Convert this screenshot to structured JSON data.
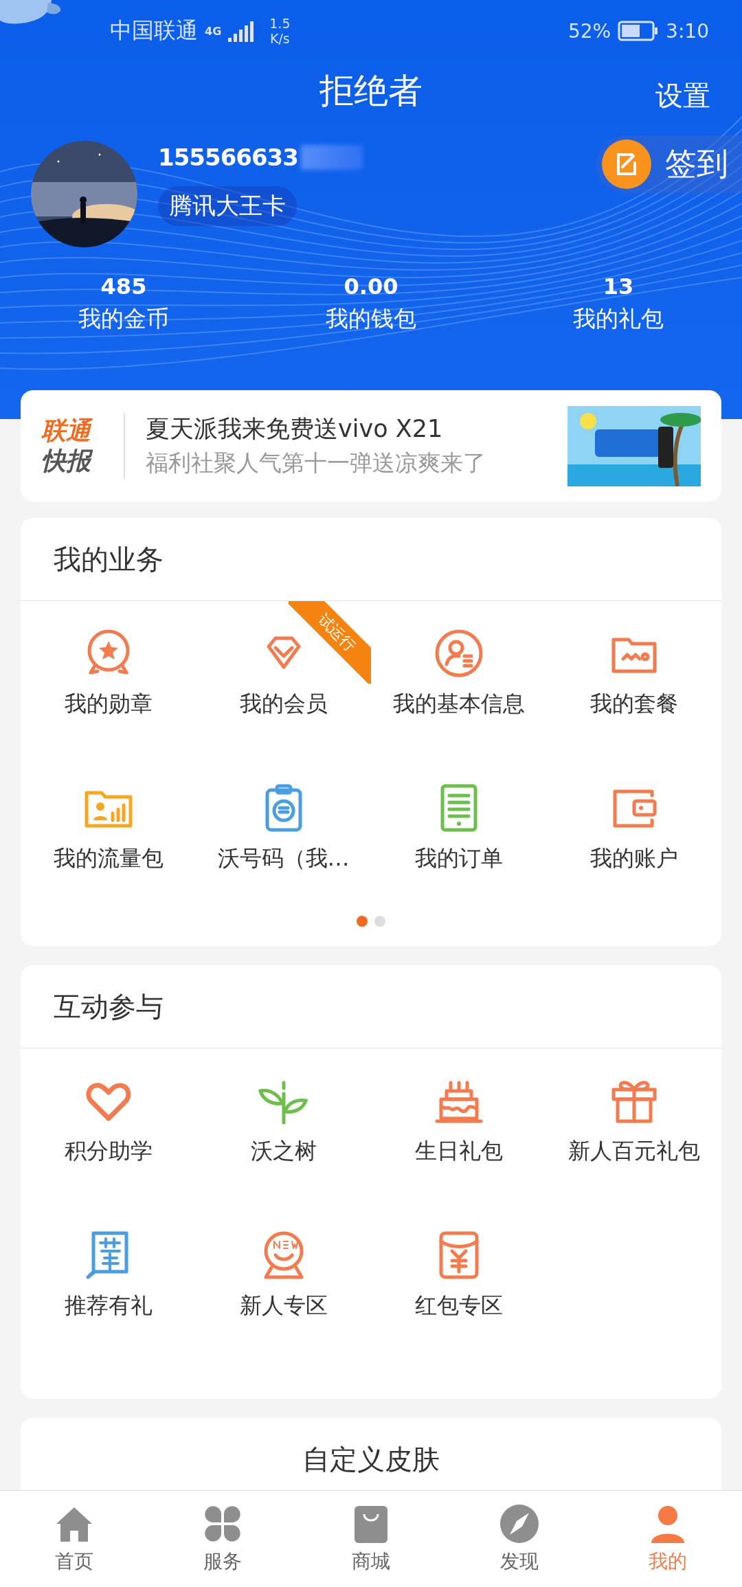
{
  "status_bar": {
    "carrier": "中国联通",
    "network": "4G",
    "speed_value": "1.5",
    "speed_unit": "K/s",
    "battery": "52%",
    "time": "3:10"
  },
  "header": {
    "title": "拒绝者",
    "settings": "设置",
    "phone": "155566633",
    "card_tag": "腾讯大王卡",
    "checkin": "签到"
  },
  "stats": [
    {
      "value": "485",
      "label": "我的金币"
    },
    {
      "value": "0.00",
      "label": "我的钱包"
    },
    {
      "value": "13",
      "label": "我的礼包"
    }
  ],
  "news": {
    "logo_top": "联通",
    "logo_bottom": "快报",
    "headline": "夏天派我来免费送vivo X21",
    "subline": "福利社聚人气第十一弹送凉爽来了"
  },
  "services": {
    "title": "我的业务",
    "items": [
      {
        "label": "我的勋章",
        "kind": "medal",
        "color": "#f27b4f"
      },
      {
        "label": "我的会员",
        "kind": "diamond",
        "color": "#f27b4f",
        "ribbon": "试运行"
      },
      {
        "label": "我的基本信息",
        "kind": "profile",
        "color": "#f27b4f"
      },
      {
        "label": "我的套餐",
        "kind": "folder",
        "color": "#f27b4f"
      },
      {
        "label": "我的流量包",
        "kind": "datafolder",
        "color": "#f5a623"
      },
      {
        "label": "沃号码（我…",
        "kind": "clipboard",
        "color": "#4a9de0"
      },
      {
        "label": "我的订单",
        "kind": "tablet",
        "color": "#6cbf4a"
      },
      {
        "label": "我的账户",
        "kind": "wallet",
        "color": "#f27b4f"
      }
    ],
    "pages": [
      {
        "selected": true
      },
      {
        "selected": false
      }
    ]
  },
  "interact": {
    "title": "互动参与",
    "items": [
      {
        "label": "积分助学",
        "kind": "heart",
        "color": "#f27b4f"
      },
      {
        "label": "沃之树",
        "kind": "sprout",
        "color": "#6cbf4a"
      },
      {
        "label": "生日礼包",
        "kind": "cake",
        "color": "#f27b4f"
      },
      {
        "label": "新人百元礼包",
        "kind": "gift",
        "color": "#f27b4f"
      },
      {
        "label": "推荐有礼",
        "kind": "recommend",
        "color": "#4a9de0"
      },
      {
        "label": "新人专区",
        "kind": "newbie",
        "color": "#f27b4f"
      },
      {
        "label": "红包专区",
        "kind": "envelope",
        "color": "#f27b4f"
      }
    ]
  },
  "skin": {
    "title": "自定义皮肤"
  },
  "tabs": [
    {
      "label": "首页",
      "kind": "home",
      "selected": false
    },
    {
      "label": "服务",
      "kind": "clover",
      "selected": false
    },
    {
      "label": "商城",
      "kind": "bag",
      "selected": false
    },
    {
      "label": "发现",
      "kind": "compass",
      "selected": false
    },
    {
      "label": "我的",
      "kind": "person",
      "selected": true
    }
  ]
}
